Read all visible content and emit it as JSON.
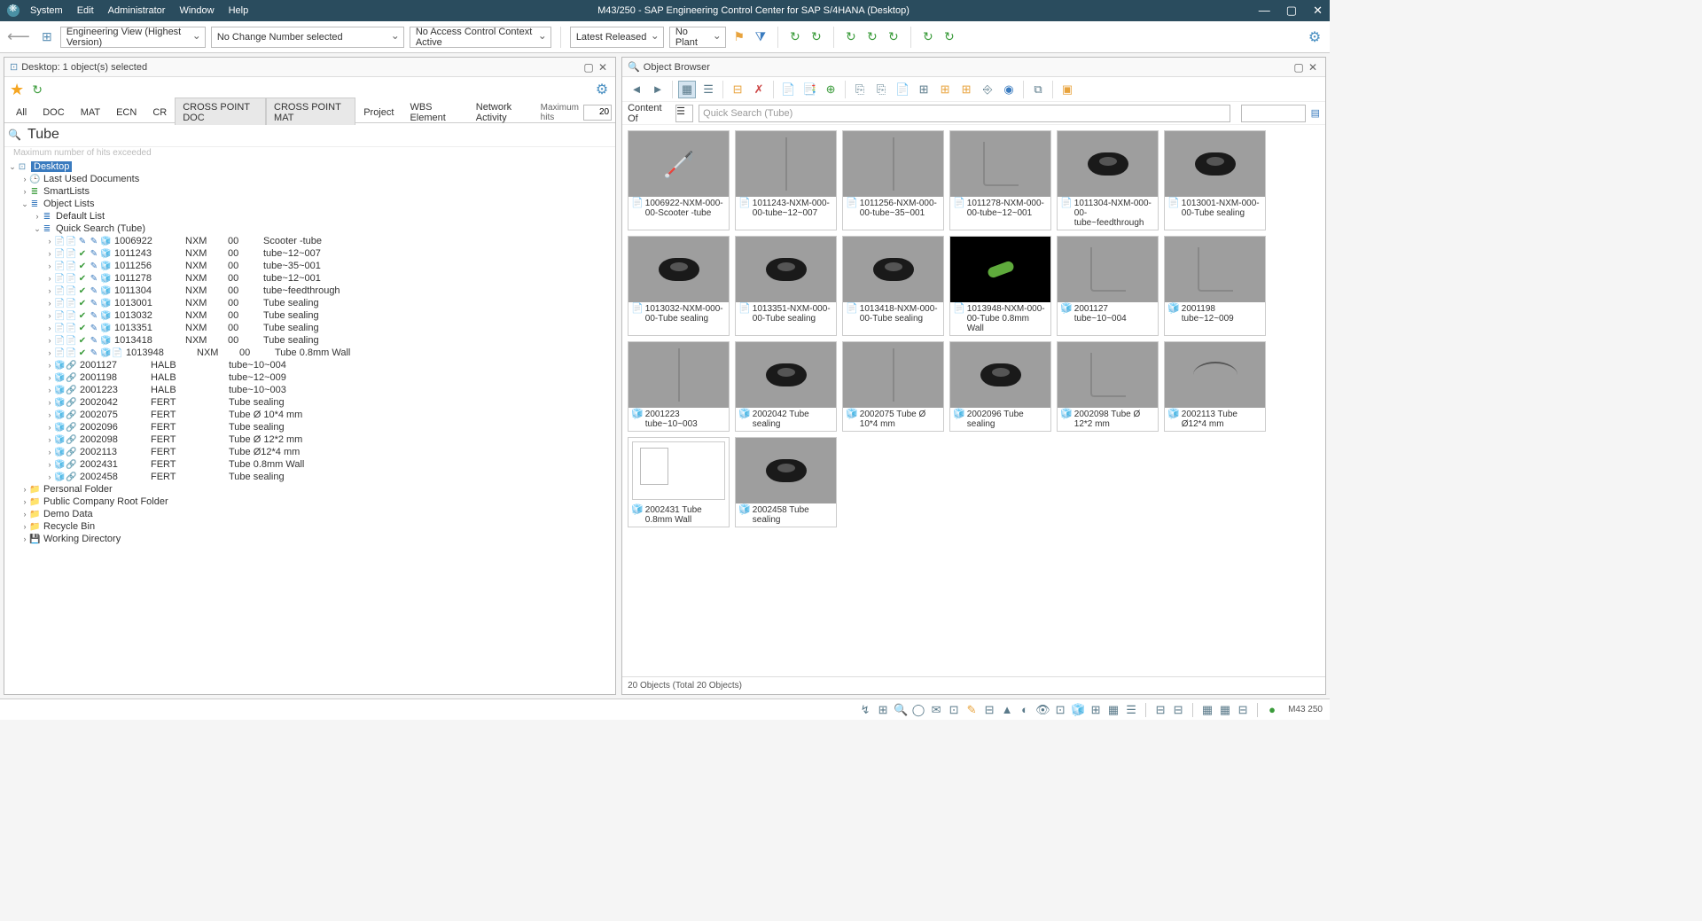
{
  "titlebar": {
    "menus": [
      "System",
      "Edit",
      "Administrator",
      "Window",
      "Help"
    ],
    "title": "M43/250 - SAP Engineering Control Center for SAP S/4HANA (Desktop)"
  },
  "main_toolbar": {
    "selects": {
      "view": "Engineering View (Highest Version)",
      "change_no": "No Change Number selected",
      "access_ctx": "No Access Control Context Active",
      "status": "Latest Released",
      "plant": "No Plant"
    }
  },
  "left_panel": {
    "title": "Desktop: 1 object(s) selected",
    "tabs": [
      "All",
      "DOC",
      "MAT",
      "ECN",
      "CR",
      "CROSS POINT DOC",
      "CROSS POINT MAT",
      "Project",
      "WBS Element",
      "Network Activity"
    ],
    "active_tabs": [
      5,
      6
    ],
    "max_hits_label": "Maximum hits",
    "max_hits_value": "20",
    "search_value": "Tube",
    "hits_msg": "Maximum number of hits exceeded",
    "tree": {
      "root": "Desktop",
      "top_nodes": [
        {
          "label": "Last Used Documents",
          "icon": "🕒"
        },
        {
          "label": "SmartLists",
          "icon": "≣"
        },
        {
          "label": "Object Lists",
          "icon": "≣",
          "expanded": true
        },
        {
          "label": "Personal Folder",
          "icon": "📁"
        },
        {
          "label": "Public Company Root Folder",
          "icon": "📁"
        },
        {
          "label": "Demo Data",
          "icon": "📁"
        },
        {
          "label": "Recycle Bin",
          "icon": "📁"
        },
        {
          "label": "Working Directory",
          "icon": "💾"
        }
      ],
      "object_lists": [
        {
          "label": "Default List"
        },
        {
          "label": "Quick Search (Tube)",
          "expanded": true
        }
      ],
      "search_results_doc": [
        {
          "id": "1006922",
          "c2": "NXM",
          "c3": "00",
          "desc": "Scooter -tube"
        },
        {
          "id": "1011243",
          "c2": "NXM",
          "c3": "00",
          "desc": "tube~12~007"
        },
        {
          "id": "1011256",
          "c2": "NXM",
          "c3": "00",
          "desc": "tube~35~001"
        },
        {
          "id": "1011278",
          "c2": "NXM",
          "c3": "00",
          "desc": "tube~12~001"
        },
        {
          "id": "1011304",
          "c2": "NXM",
          "c3": "00",
          "desc": "tube~feedthrough"
        },
        {
          "id": "1013001",
          "c2": "NXM",
          "c3": "00",
          "desc": "Tube sealing"
        },
        {
          "id": "1013032",
          "c2": "NXM",
          "c3": "00",
          "desc": "Tube sealing"
        },
        {
          "id": "1013351",
          "c2": "NXM",
          "c3": "00",
          "desc": "Tube sealing"
        },
        {
          "id": "1013418",
          "c2": "NXM",
          "c3": "00",
          "desc": "Tube sealing"
        },
        {
          "id": "1013948",
          "c2": "NXM",
          "c3": "00",
          "desc": "Tube 0.8mm Wall"
        }
      ],
      "search_results_mat": [
        {
          "id": "2001127",
          "c2": "HALB",
          "desc": "tube~10~004"
        },
        {
          "id": "2001198",
          "c2": "HALB",
          "desc": "tube~12~009"
        },
        {
          "id": "2001223",
          "c2": "HALB",
          "desc": "tube~10~003"
        },
        {
          "id": "2002042",
          "c2": "FERT",
          "desc": "Tube sealing"
        },
        {
          "id": "2002075",
          "c2": "FERT",
          "desc": "Tube Ø 10*4 mm"
        },
        {
          "id": "2002096",
          "c2": "FERT",
          "desc": "Tube sealing"
        },
        {
          "id": "2002098",
          "c2": "FERT",
          "desc": "Tube Ø 12*2 mm"
        },
        {
          "id": "2002113",
          "c2": "FERT",
          "desc": "Tube Ø12*4 mm"
        },
        {
          "id": "2002431",
          "c2": "FERT",
          "desc": "Tube 0.8mm Wall"
        },
        {
          "id": "2002458",
          "c2": "FERT",
          "desc": "Tube sealing"
        }
      ]
    }
  },
  "right_panel": {
    "title": "Object Browser",
    "content_of_label": "Content Of",
    "quick_search_placeholder": "Quick Search (Tube)",
    "thumbnails": [
      {
        "caption": "1006922-NXM-000-00-Scooter -tube",
        "shape": "scooter",
        "iconcolor": "#e8a33d"
      },
      {
        "caption": "1011243-NXM-000-00-tube~12~007",
        "shape": "line",
        "iconcolor": "#e8a33d"
      },
      {
        "caption": "1011256-NXM-000-00-tube~35~001",
        "shape": "line",
        "iconcolor": "#e8a33d"
      },
      {
        "caption": "1011278-NXM-000-00-tube~12~001",
        "shape": "bent",
        "iconcolor": "#e8a33d"
      },
      {
        "caption": "1011304-NXM-000-00-tube~feedthrough",
        "shape": "ring",
        "iconcolor": "#e8a33d"
      },
      {
        "caption": "1013001-NXM-000-00-Tube sealing",
        "shape": "ring",
        "iconcolor": "#e8a33d"
      },
      {
        "caption": "1013032-NXM-000-00-Tube sealing",
        "shape": "ring",
        "iconcolor": "#e8a33d"
      },
      {
        "caption": "1013351-NXM-000-00-Tube sealing",
        "shape": "ring",
        "iconcolor": "#e8a33d"
      },
      {
        "caption": "1013418-NXM-000-00-Tube sealing",
        "shape": "ring",
        "iconcolor": "#e8a33d"
      },
      {
        "caption": "1013948-NXM-000-00-Tube 0.8mm Wall",
        "shape": "green",
        "bg": "dark",
        "iconcolor": "#e8a33d"
      },
      {
        "caption": "2001127 tube~10~004",
        "shape": "bent",
        "iconcolor": "#5a8fb5",
        "mat": true
      },
      {
        "caption": "2001198 tube~12~009",
        "shape": "bent",
        "iconcolor": "#5a8fb5",
        "mat": true
      },
      {
        "caption": "2001223 tube~10~003",
        "shape": "line",
        "iconcolor": "#5a8fb5",
        "mat": true
      },
      {
        "caption": "2002042 Tube sealing",
        "shape": "ring",
        "iconcolor": "#5a8fb5",
        "mat": true
      },
      {
        "caption": "2002075 Tube Ø 10*4 mm",
        "shape": "line",
        "iconcolor": "#5a8fb5",
        "mat": true
      },
      {
        "caption": "2002096 Tube sealing",
        "shape": "ring",
        "iconcolor": "#5a8fb5",
        "mat": true
      },
      {
        "caption": "2002098 Tube Ø 12*2 mm",
        "shape": "bent",
        "iconcolor": "#5a8fb5",
        "mat": true
      },
      {
        "caption": "2002113 Tube Ø12*4 mm",
        "shape": "curve",
        "iconcolor": "#5a8fb5",
        "mat": true
      },
      {
        "caption": "2002431 Tube 0.8mm Wall",
        "shape": "drawing",
        "bg": "white",
        "iconcolor": "#5a8fb5",
        "mat": true
      },
      {
        "caption": "2002458 Tube sealing",
        "shape": "ring",
        "iconcolor": "#5a8fb5",
        "mat": true
      }
    ],
    "status": "20 Objects (Total 20 Objects)"
  },
  "statusbar": {
    "server": "M43 250"
  }
}
